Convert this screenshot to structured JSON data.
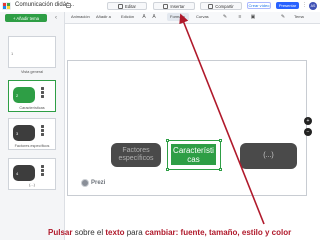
{
  "app": {
    "title": "Comunicación didác..."
  },
  "tabs": [
    {
      "label": "Editar"
    },
    {
      "label": "Insertar"
    },
    {
      "label": "Compartir"
    }
  ],
  "header": {
    "share_label": "Crear vídeo",
    "present_label": "Presentar",
    "avatar_initials": "AS"
  },
  "left_panel": {
    "add_topic_label": "+ Añadir tema",
    "thumbnails": [
      {
        "number": "1",
        "label": "Vista general"
      },
      {
        "number": "2",
        "label": "Características"
      },
      {
        "number": "3",
        "label": "Factores específicos"
      },
      {
        "number": "4",
        "label": "(...)"
      }
    ]
  },
  "toolbar": {
    "items": [
      "Animación",
      "Añadir a",
      "Edición",
      "Estilo",
      "Formato",
      "Curvas",
      "Tema"
    ]
  },
  "canvas": {
    "topic1": [
      "Factores",
      "específicos"
    ],
    "topic2": [
      "Característi",
      "cas"
    ],
    "topic3": "(...)",
    "prezi_label": "Prezi"
  },
  "caption": {
    "p1": "Pulsar",
    "p2": " sobre el ",
    "p3": "texto",
    "p4": " para ",
    "p5": "cambiar: fuente, tamaño, estilo y color"
  },
  "colors": {
    "accent_green": "#2e9e45",
    "present_blue": "#2962ff",
    "arrow_red": "#b0192b",
    "topic_dark": "#4a4a4a"
  }
}
